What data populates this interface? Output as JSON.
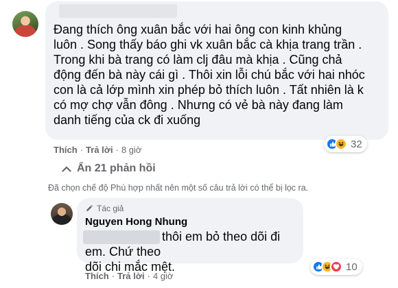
{
  "comment1": {
    "text": "Đang thích ông xuân bắc với hai ông con kinh khủng\nluôn . Song thấy báo ghi vk xuân bắc cà khịa trang trần .\nTrong khi bà trang có làm clj đâu mà khịa . Cũng chả\nđộng đến bà này cái gì . Thôi xin lỗi chú bắc với hai nhóc\ncon là cả lớp mình xin phép bỏ thích luôn . Tất nhiên là k\ncó mợ chợ vẫn đông . Nhưng có vẻ bà này đang làm\ndanh tiếng của ck đi xuống",
    "like_label": "Thích",
    "reply_label": "Trả lời",
    "time": "8 giờ",
    "reaction_count": "32",
    "reactions": [
      "like-icon",
      "haha-icon"
    ]
  },
  "replies_toggle": {
    "label": "Ẩn 21 phản hồi"
  },
  "filter_note": "Đã chọn chế độ Phù hợp nhất nên một số câu trả lời có thể bị lọc ra.",
  "reply1": {
    "badge": "Tác giả",
    "author": "Nguyen Hong Nhung",
    "text": "thôi em bỏ theo dõi đi em. Chứ theo\ndõi chi mắc mệt.",
    "like_label": "Thích",
    "reply_label": "Trả lời",
    "time": "4 giờ",
    "reaction_count": "10",
    "reactions": [
      "like-icon",
      "haha-icon",
      "love-icon"
    ]
  },
  "colors": {
    "bubble": "#f0f2f5",
    "secondary_text": "#65676b",
    "like": "#1877f2",
    "haha": "#f7b928",
    "love": "#f33e58"
  }
}
